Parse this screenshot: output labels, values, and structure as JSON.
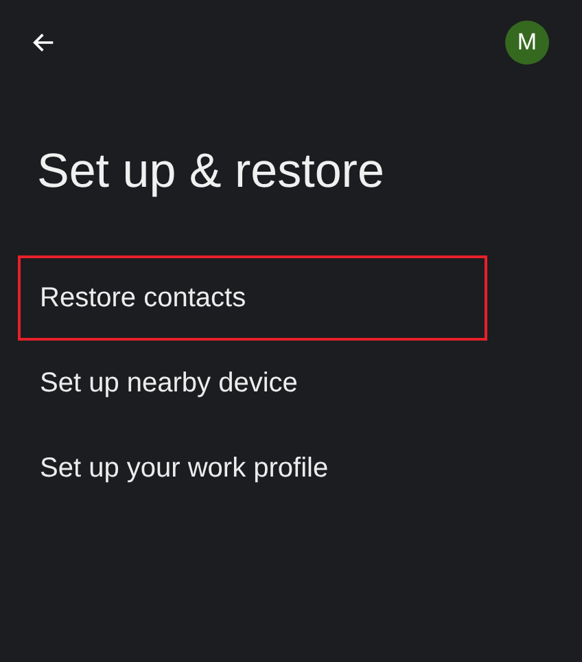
{
  "top_bar": {
    "avatar_letter": "M"
  },
  "title": "Set up & restore",
  "items": [
    {
      "label": "Restore contacts",
      "highlighted": true
    },
    {
      "label": "Set up nearby device",
      "highlighted": false
    },
    {
      "label": "Set up your work profile",
      "highlighted": false
    }
  ]
}
